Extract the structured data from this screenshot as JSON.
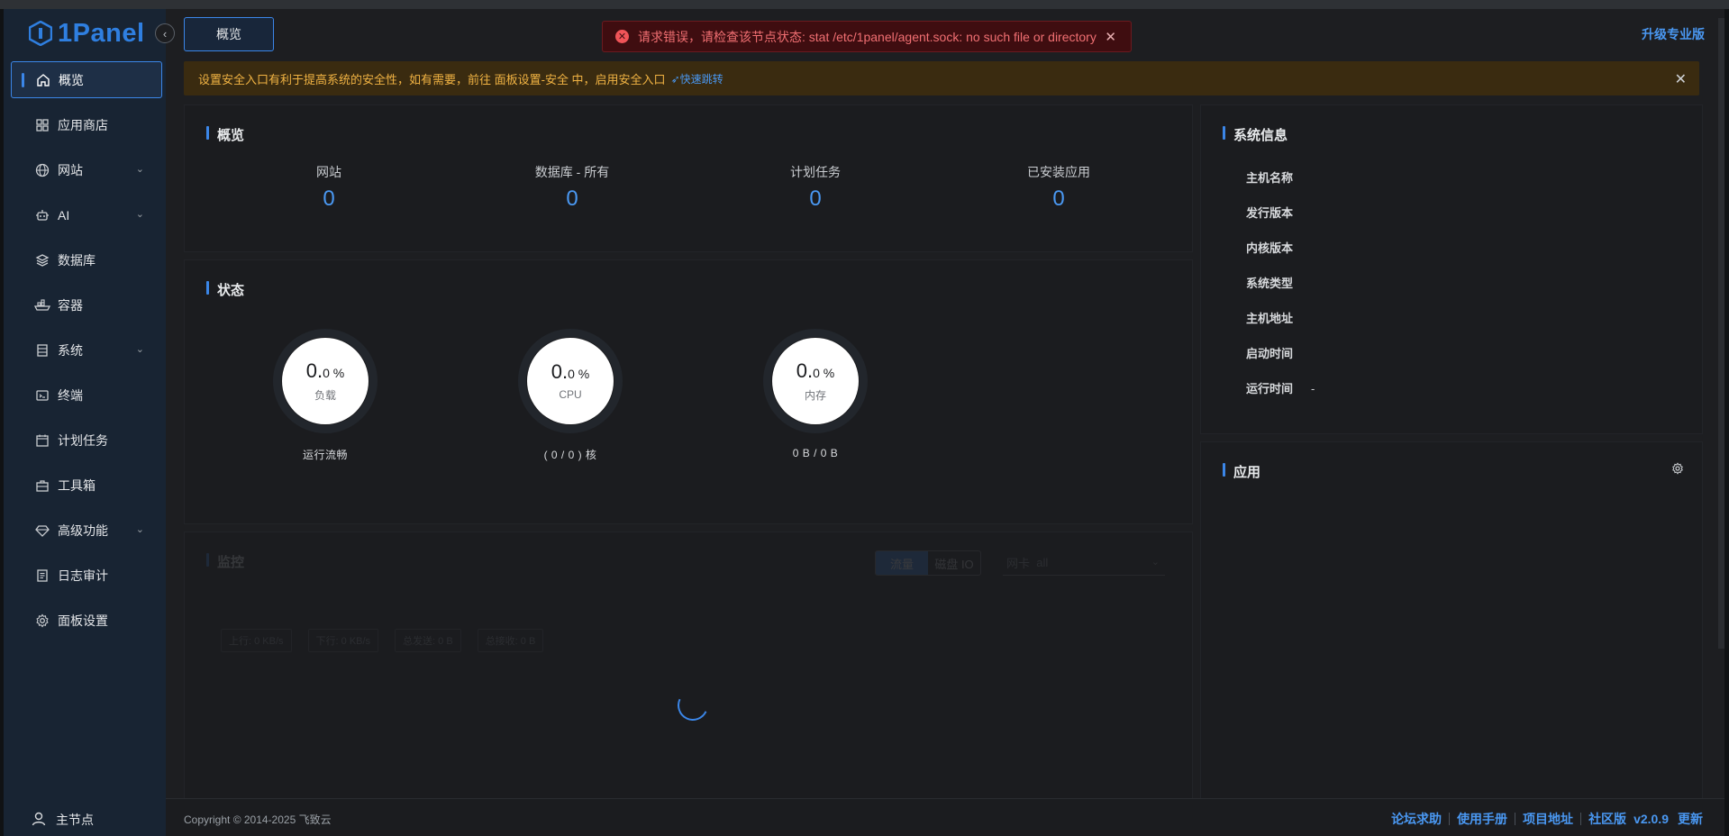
{
  "app": {
    "logo_text": "1Panel",
    "collapse_icon": "chevron-left-icon"
  },
  "header": {
    "active_tab": "概览",
    "upgrade_label": "升级专业版"
  },
  "toast": {
    "message": "请求错误，请检查该节点状态: stat /etc/1panel/agent.sock: no such file or directory"
  },
  "banner": {
    "message": "设置安全入口有利于提高系统的安全性，如有需要，前往 面板设置-安全 中，启用安全入口",
    "link_label": "快速跳转"
  },
  "sidebar": {
    "items": [
      {
        "label": "概览",
        "icon": "home-icon",
        "active": true
      },
      {
        "label": "应用商店",
        "icon": "grid-icon"
      },
      {
        "label": "网站",
        "icon": "globe-icon",
        "expandable": true
      },
      {
        "label": "AI",
        "icon": "robot-icon",
        "expandable": true
      },
      {
        "label": "数据库",
        "icon": "layers-icon"
      },
      {
        "label": "容器",
        "icon": "container-ship-icon"
      },
      {
        "label": "系统",
        "icon": "server-icon",
        "expandable": true
      },
      {
        "label": "终端",
        "icon": "terminal-icon"
      },
      {
        "label": "计划任务",
        "icon": "calendar-icon"
      },
      {
        "label": "工具箱",
        "icon": "toolbox-icon"
      },
      {
        "label": "高级功能",
        "icon": "diamond-icon",
        "expandable": true
      },
      {
        "label": "日志审计",
        "icon": "log-icon"
      },
      {
        "label": "面板设置",
        "icon": "gear-icon"
      }
    ],
    "node_label": "主节点"
  },
  "overview": {
    "title": "概览",
    "cells": [
      {
        "label": "网站",
        "value": "0"
      },
      {
        "label": "数据库 - 所有",
        "value": "0"
      },
      {
        "label": "计划任务",
        "value": "0"
      },
      {
        "label": "已安装应用",
        "value": "0"
      }
    ]
  },
  "status": {
    "title": "状态",
    "gauges": [
      {
        "int": "0.",
        "dec": "0 %",
        "caption": "负载",
        "sub": "运行流畅"
      },
      {
        "int": "0.",
        "dec": "0 %",
        "caption": "CPU",
        "sub": "( 0 / 0 ) 核"
      },
      {
        "int": "0.",
        "dec": "0 %",
        "caption": "内存",
        "sub": "0 B / 0 B"
      }
    ]
  },
  "monitor": {
    "title": "监控",
    "tabs": [
      "流量",
      "磁盘 IO"
    ],
    "nic_label": "网卡",
    "nic_value": "all",
    "stats": [
      "上行: 0 KB/s",
      "下行: 0 KB/s",
      "总发送: 0 B",
      "总接收: 0 B"
    ]
  },
  "sysinfo": {
    "title": "系统信息",
    "rows": [
      {
        "label": "主机名称",
        "value": ""
      },
      {
        "label": "发行版本",
        "value": ""
      },
      {
        "label": "内核版本",
        "value": ""
      },
      {
        "label": "系统类型",
        "value": ""
      },
      {
        "label": "主机地址",
        "value": ""
      },
      {
        "label": "启动时间",
        "value": ""
      },
      {
        "label": "运行时间",
        "value": "-"
      }
    ]
  },
  "apps": {
    "title": "应用"
  },
  "footer": {
    "copyright": "Copyright © 2014-2025 飞致云",
    "links": [
      "论坛求助",
      "使用手册",
      "项目地址"
    ],
    "edition": "社区版",
    "version": "v2.0.9",
    "update": "更新"
  },
  "colors": {
    "accent": "#3b86e8",
    "error": "#f05458",
    "warning": "#f1b343",
    "bg": "#1d1e21"
  }
}
